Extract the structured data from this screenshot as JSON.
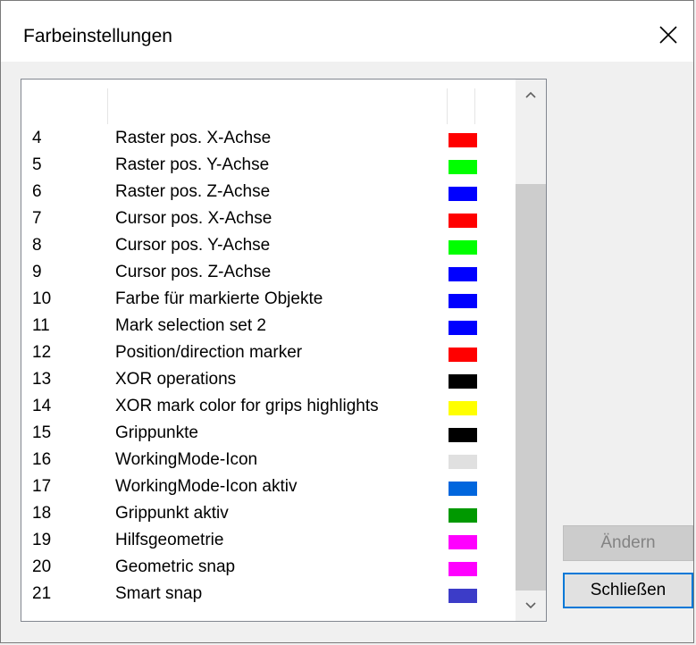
{
  "dialog": {
    "title": "Farbeinstellungen",
    "buttons": {
      "change_label": "Ändern",
      "close_label": "Schließen"
    }
  },
  "colors": {
    "window_bg": "#f0f0f0",
    "accent_focus": "#0078d7"
  },
  "color_list": {
    "rows": [
      {
        "index": "4",
        "label": "Raster pos. X-Achse",
        "color": "#ff0000"
      },
      {
        "index": "5",
        "label": "Raster pos. Y-Achse",
        "color": "#00ff00"
      },
      {
        "index": "6",
        "label": "Raster pos. Z-Achse",
        "color": "#0000ff"
      },
      {
        "index": "7",
        "label": "Cursor pos. X-Achse",
        "color": "#ff0000"
      },
      {
        "index": "8",
        "label": "Cursor pos. Y-Achse",
        "color": "#00ff00"
      },
      {
        "index": "9",
        "label": "Cursor pos. Z-Achse",
        "color": "#0000ff"
      },
      {
        "index": "10",
        "label": "Farbe für markierte Objekte",
        "color": "#0000ff"
      },
      {
        "index": "11",
        "label": "Mark selection set 2",
        "color": "#0000ff"
      },
      {
        "index": "12",
        "label": "Position/direction marker",
        "color": "#ff0000"
      },
      {
        "index": "13",
        "label": "XOR operations",
        "color": "#000000"
      },
      {
        "index": "14",
        "label": "XOR mark color for grips highlights",
        "color": "#ffff00"
      },
      {
        "index": "15",
        "label": "Grippunkte",
        "color": "#000000"
      },
      {
        "index": "16",
        "label": "WorkingMode-Icon",
        "color": "#e0e0e0"
      },
      {
        "index": "17",
        "label": "WorkingMode-Icon aktiv",
        "color": "#0066dd"
      },
      {
        "index": "18",
        "label": "Grippunkt aktiv",
        "color": "#009900"
      },
      {
        "index": "19",
        "label": "Hilfsgeometrie",
        "color": "#ff00ff"
      },
      {
        "index": "20",
        "label": "Geometric snap",
        "color": "#ff00ff"
      },
      {
        "index": "21",
        "label": "Smart snap",
        "color": "#3c3cc8"
      }
    ]
  },
  "scrollbar": {
    "up_icon": "chevron-up-icon",
    "down_icon": "chevron-down-icon"
  }
}
